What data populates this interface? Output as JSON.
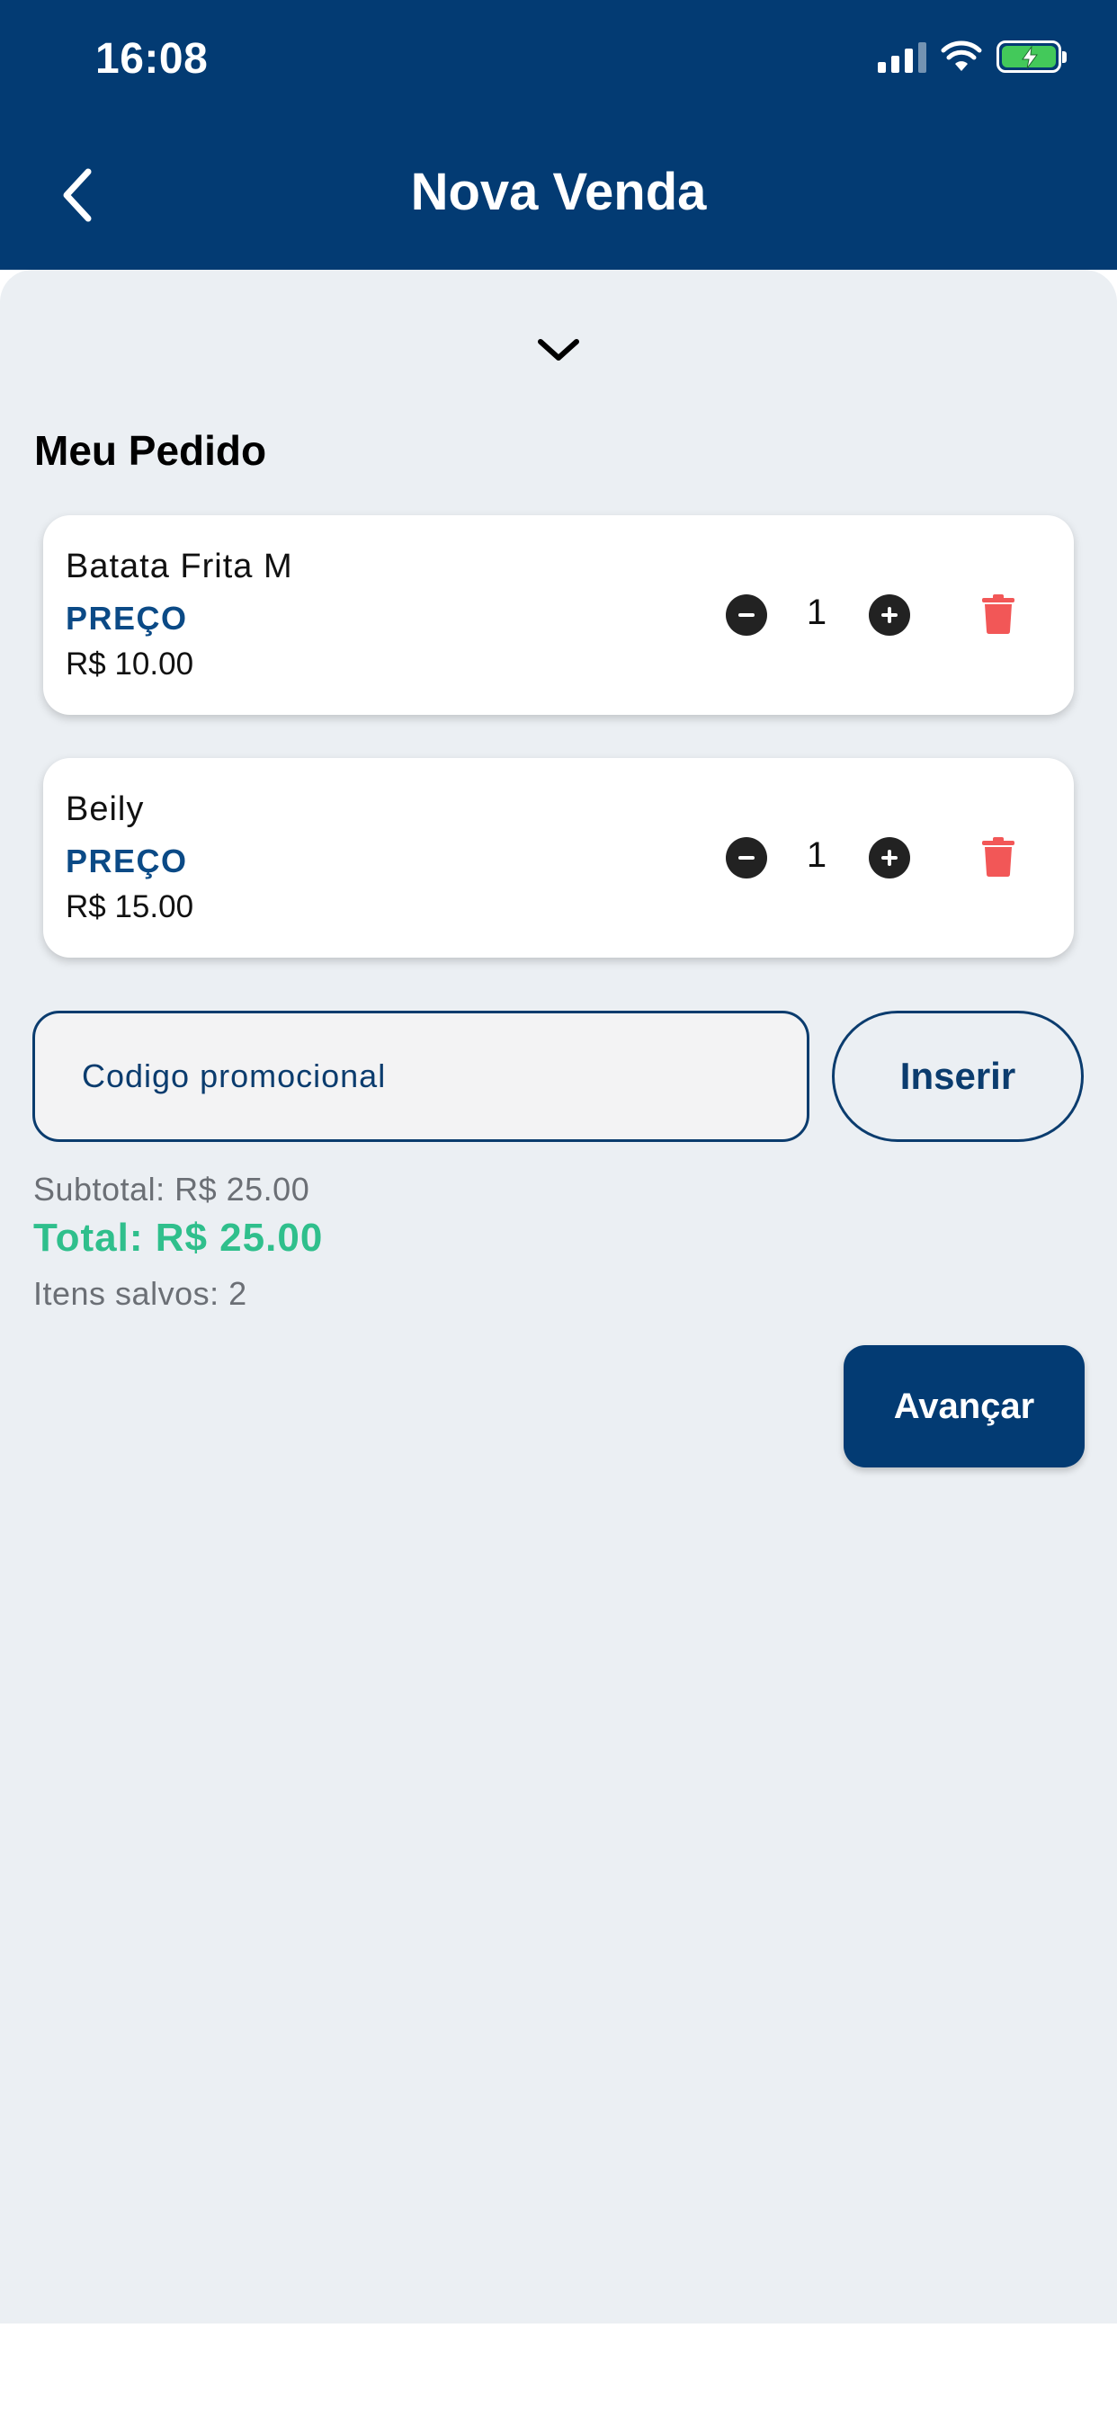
{
  "status_bar": {
    "time": "16:08"
  },
  "header": {
    "title": "Nova Venda"
  },
  "order": {
    "section_title": "Meu Pedido",
    "items": [
      {
        "name": "Batata Frita M",
        "price_label": "PREÇO",
        "price": "R$ 10.00",
        "quantity": "1"
      },
      {
        "name": "Beily",
        "price_label": "PREÇO",
        "price": "R$ 15.00",
        "quantity": "1"
      }
    ]
  },
  "promo": {
    "placeholder": "Codigo promocional",
    "button_label": "Inserir"
  },
  "summary": {
    "subtotal": "Subtotal: R$ 25.00",
    "total": "Total: R$ 25.00",
    "saved_items": "Itens salvos: 2"
  },
  "actions": {
    "advance_label": "Avançar"
  },
  "colors": {
    "primary": "#033b73",
    "background": "#ebeff3",
    "total_green": "#2fbf8c",
    "delete_red": "#f25757",
    "price_label_blue": "#0b4a86"
  },
  "icons": {
    "back": "chevron-left-icon",
    "collapse": "chevron-down-icon",
    "decrease": "minus-circle-icon",
    "increase": "plus-circle-icon",
    "delete": "trash-icon"
  }
}
